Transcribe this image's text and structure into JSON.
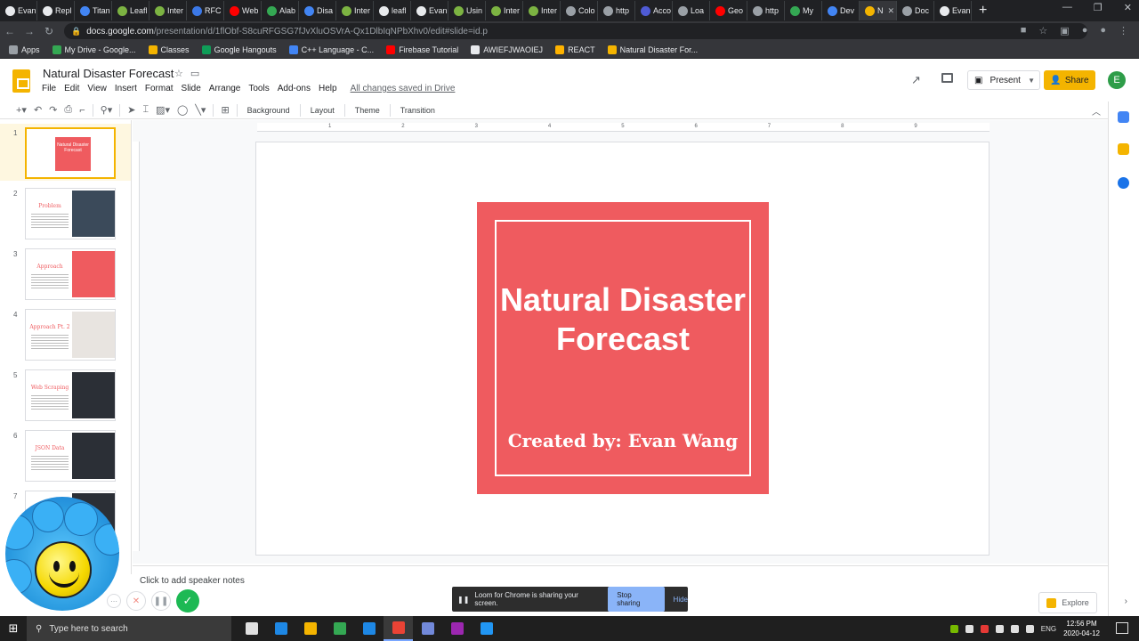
{
  "browser": {
    "tabs": [
      {
        "label": "Evan",
        "color": "#e8eaed"
      },
      {
        "label": "Repl",
        "color": "#e8eaed"
      },
      {
        "label": "Titan",
        "color": "#4285f4"
      },
      {
        "label": "Leafl",
        "color": "#7cb342"
      },
      {
        "label": "Inter",
        "color": "#7cb342"
      },
      {
        "label": "RFC",
        "color": "#3b78e7"
      },
      {
        "label": "Web",
        "color": "#ff0000"
      },
      {
        "label": "Alab",
        "color": "#34a853"
      },
      {
        "label": "Disa",
        "color": "#4285f4"
      },
      {
        "label": "Inter",
        "color": "#7cb342"
      },
      {
        "label": "leafl",
        "color": "#e8eaed"
      },
      {
        "label": "Evan",
        "color": "#e8eaed"
      },
      {
        "label": "Usin",
        "color": "#7cb342"
      },
      {
        "label": "Inter",
        "color": "#7cb342"
      },
      {
        "label": "Inter",
        "color": "#7cb342"
      },
      {
        "label": "Colo",
        "color": "#9aa0a6"
      },
      {
        "label": "http",
        "color": "#9aa0a6"
      },
      {
        "label": "Acco",
        "color": "#4f5bd5"
      },
      {
        "label": "Loa",
        "color": "#9aa0a6"
      },
      {
        "label": "Geo",
        "color": "#ff0000"
      },
      {
        "label": "http",
        "color": "#9aa0a6"
      },
      {
        "label": "My",
        "color": "#34a853"
      },
      {
        "label": "Dev",
        "color": "#4285f4"
      },
      {
        "label": "N",
        "color": "#f4b400",
        "active": true
      },
      {
        "label": "Doc",
        "color": "#9aa0a6"
      },
      {
        "label": "Evan",
        "color": "#e8eaed"
      }
    ],
    "window_controls": [
      "—",
      "❐",
      "✕"
    ],
    "url_host": "docs.google.com",
    "url_path": "/presentation/d/1flObf-S8cuRFGSG7fJvXluOSVrA-Qx1DlbIqNPbXhv0/edit#slide=id.p",
    "bookmarks": [
      {
        "label": "Apps",
        "color": "#9aa0a6"
      },
      {
        "label": "My Drive - Google...",
        "color": "#34a853"
      },
      {
        "label": "Classes",
        "color": "#f4b400"
      },
      {
        "label": "Google Hangouts",
        "color": "#0f9d58"
      },
      {
        "label": "C++ Language - C...",
        "color": "#4285f4"
      },
      {
        "label": "Firebase Tutorial",
        "color": "#ff0000"
      },
      {
        "label": "AWIEFJWAOIEJ",
        "color": "#e8eaed"
      },
      {
        "label": "REACT",
        "color": "#ffb300"
      },
      {
        "label": "Natural Disaster For...",
        "color": "#f4b400"
      }
    ]
  },
  "docs": {
    "title": "Natural Disaster Forecast",
    "menu": [
      "File",
      "Edit",
      "View",
      "Insert",
      "Format",
      "Slide",
      "Arrange",
      "Tools",
      "Add-ons",
      "Help"
    ],
    "saved_status": "All changes saved in Drive",
    "present_label": "Present",
    "share_label": "Share",
    "avatar_letter": "E",
    "toolbar": {
      "background": "Background",
      "layout": "Layout",
      "theme": "Theme",
      "transition": "Transition"
    }
  },
  "ruler_ticks": [
    "1",
    "2",
    "3",
    "4",
    "5",
    "6",
    "7",
    "8",
    "9"
  ],
  "slides": [
    {
      "num": "1",
      "title": "Natural Disaster Forecast",
      "selected": true
    },
    {
      "num": "2",
      "title": "Problem",
      "img": "#3b4a5a"
    },
    {
      "num": "3",
      "title": "Approach",
      "img": "#ef5b5f"
    },
    {
      "num": "4",
      "title": "Approach Pt. 2",
      "img": "#e8e4e0"
    },
    {
      "num": "5",
      "title": "Web Scraping",
      "img": "#2b2f36"
    },
    {
      "num": "6",
      "title": "JSON Data",
      "img": "#2b2f36"
    },
    {
      "num": "7",
      "title": "",
      "img": "#2b2f36"
    }
  ],
  "main_slide": {
    "title": "Natural Disaster Forecast",
    "subtitle": "Created by: Evan Wang",
    "accent": "#ef5b5f"
  },
  "notes_placeholder": "Click to add speaker notes",
  "explore_label": "Explore",
  "loom": {
    "message": "Loom for Chrome is sharing your screen.",
    "stop_label": "Stop sharing",
    "hide_label": "Hide"
  },
  "taskbar": {
    "search_placeholder": "Type here to search",
    "apps": [
      {
        "name": "task-view-icon",
        "color": "#e0e0e0"
      },
      {
        "name": "edge-icon",
        "color": "#1e88e5"
      },
      {
        "name": "file-explorer-icon",
        "color": "#f4b400"
      },
      {
        "name": "store-icon",
        "color": "#34a853"
      },
      {
        "name": "mail-icon",
        "color": "#1e88e5"
      },
      {
        "name": "chrome-icon",
        "color": "#ea4335",
        "active": true
      },
      {
        "name": "discord-icon",
        "color": "#7289da"
      },
      {
        "name": "obs-icon",
        "color": "#9c27b0"
      },
      {
        "name": "vscode-icon",
        "color": "#2196f3"
      }
    ],
    "lang": "ENG",
    "time": "12:56 PM",
    "date": "2020-04-12"
  }
}
